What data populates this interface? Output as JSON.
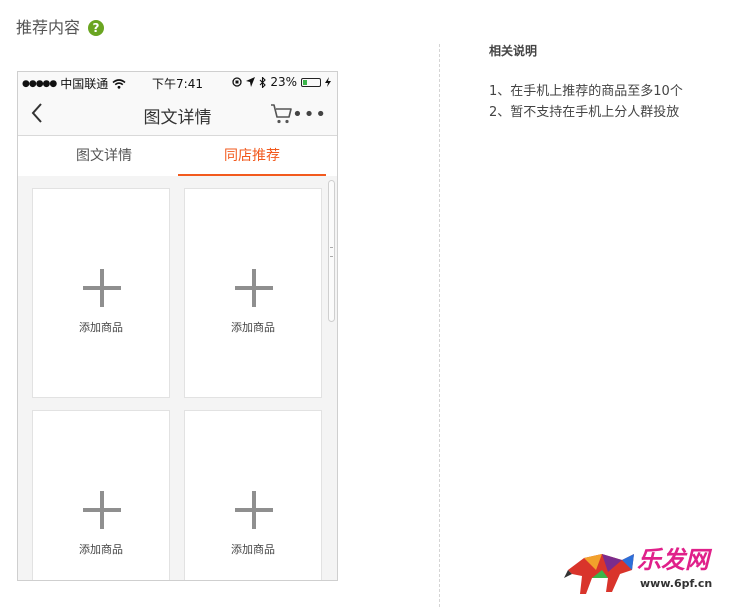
{
  "section": {
    "title": "推荐内容",
    "help_icon": "question-circle-icon",
    "help_glyph": "?"
  },
  "phone": {
    "status_bar": {
      "signal": "●●●●●",
      "carrier": "中国联通",
      "time": "下午7:41",
      "battery": "23%",
      "battery_level": 0.23
    },
    "nav": {
      "title": "图文详情",
      "more_glyph": "•••"
    },
    "tabs": [
      {
        "label": "图文详情",
        "active": false
      },
      {
        "label": "同店推荐",
        "active": true
      }
    ],
    "cards": [
      {
        "label": "添加商品"
      },
      {
        "label": "添加商品"
      },
      {
        "label": "添加商品"
      },
      {
        "label": "添加商品"
      }
    ]
  },
  "notes": {
    "heading": "相关说明",
    "items": [
      "1、在手机上推荐的商品至多10个",
      "2、暂不支持在手机上分人群投放"
    ]
  },
  "watermark": {
    "text": "乐发网",
    "url": "www.6pf.cn"
  },
  "colors": {
    "accent": "#f25a1e",
    "help": "#6aa521"
  }
}
